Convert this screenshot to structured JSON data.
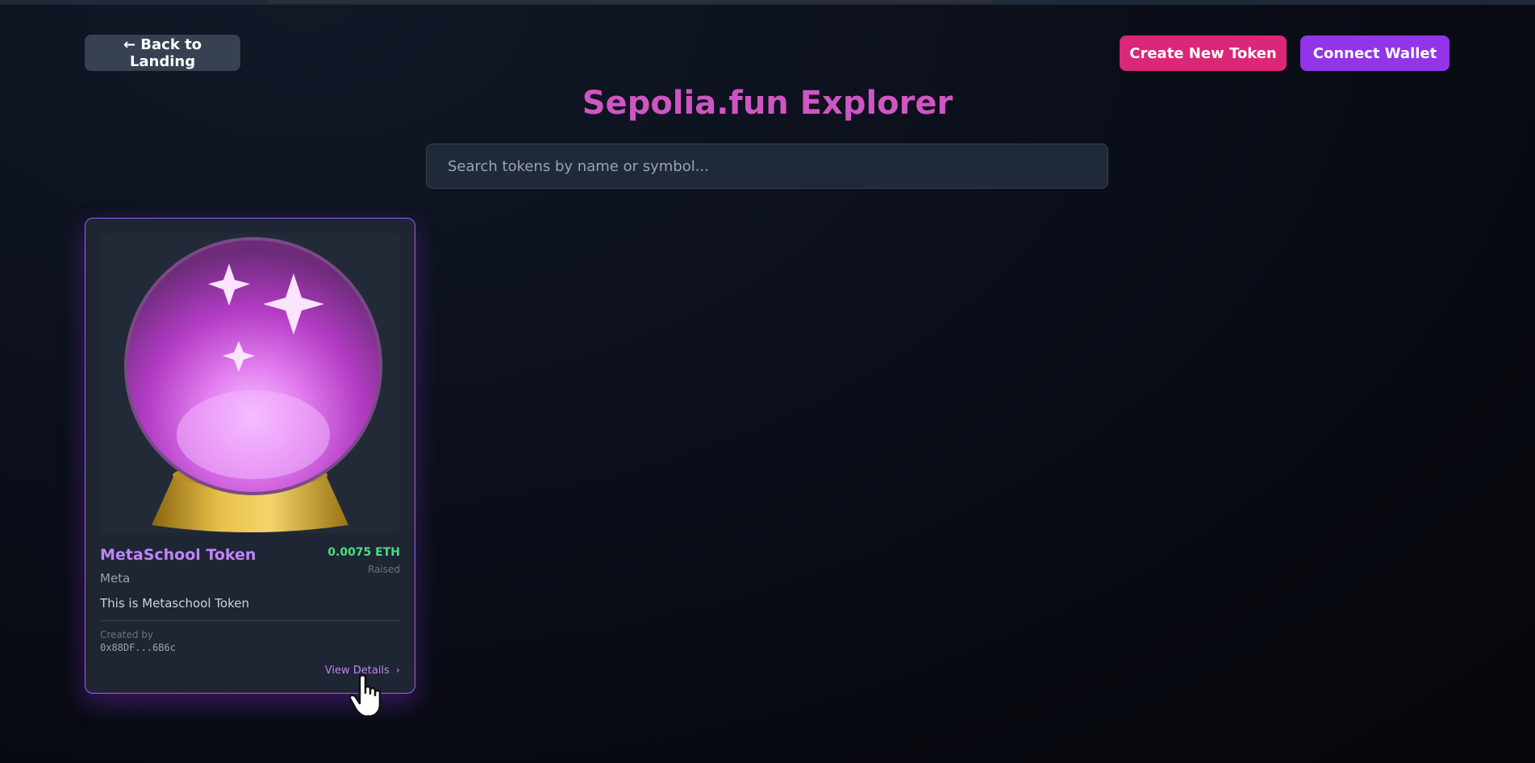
{
  "nav": {
    "back_label": "← Back to Landing",
    "create_label": "Create New Token",
    "connect_label": "Connect Wallet"
  },
  "page": {
    "title": "Sepolia.fun Explorer"
  },
  "search": {
    "placeholder": "Search tokens by name or symbol...",
    "value": ""
  },
  "tokens": [
    {
      "name": "MetaSchool Token",
      "symbol": "Meta",
      "description": "This is Metaschool Token",
      "raised": "0.0075 ETH",
      "raised_label": "Raised",
      "created_by_label": "Created by",
      "creator": "0x88DF...6B6c",
      "view_details_label": "View Details",
      "image_icon": "crystal-ball-icon"
    }
  ],
  "colors": {
    "title": "#d055c2",
    "create_button": "#db2777",
    "connect_button": "#9333ea",
    "back_button": "#374151",
    "card_border": "#a855f7",
    "token_name": "#c084fc",
    "raised": "#4ade80"
  }
}
